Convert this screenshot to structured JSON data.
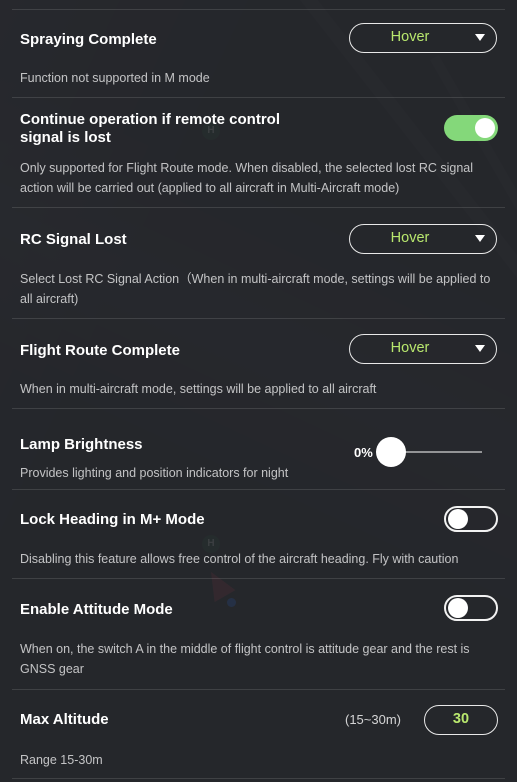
{
  "colors": {
    "accent_value": "#b9e86e",
    "toggle_on": "#84d87a"
  },
  "settings": [
    {
      "title": "Spraying Complete",
      "control": "dropdown",
      "value": "Hover",
      "icon": "caret-down-icon",
      "description": "Function not supported in M mode"
    },
    {
      "title": "Continue operation if remote control signal is lost",
      "control": "toggle",
      "on": true,
      "description": "Only supported for Flight Route mode. When disabled, the selected lost RC signal action will be carried out (applied to all aircraft in Multi-Aircraft mode)"
    },
    {
      "title": "RC Signal Lost",
      "control": "dropdown",
      "value": "Hover",
      "icon": "caret-down-icon",
      "description": "Select Lost RC Signal Action（When in multi-aircraft mode, settings will be applied to all aircraft)"
    },
    {
      "title": "Flight Route Complete",
      "control": "dropdown",
      "value": "Hover",
      "icon": "caret-down-icon",
      "description": "When in multi-aircraft mode, settings will be applied to all aircraft"
    },
    {
      "title": "Lamp Brightness",
      "control": "slider",
      "value_label": "0%",
      "value": 0,
      "description": "Provides lighting and position indicators for night"
    },
    {
      "title": "Lock Heading in M+ Mode",
      "control": "toggle",
      "on": false,
      "description": "Disabling this feature allows free control of the aircraft heading. Fly with caution"
    },
    {
      "title": "Enable Attitude Mode",
      "control": "toggle",
      "on": false,
      "description": "When on, the switch A in the middle of flight control is attitude gear and the rest is GNSS gear"
    },
    {
      "title": "Max Altitude",
      "control": "number",
      "range_label": "(15~30m)",
      "value": "30",
      "description": "Range 15-30m"
    }
  ]
}
